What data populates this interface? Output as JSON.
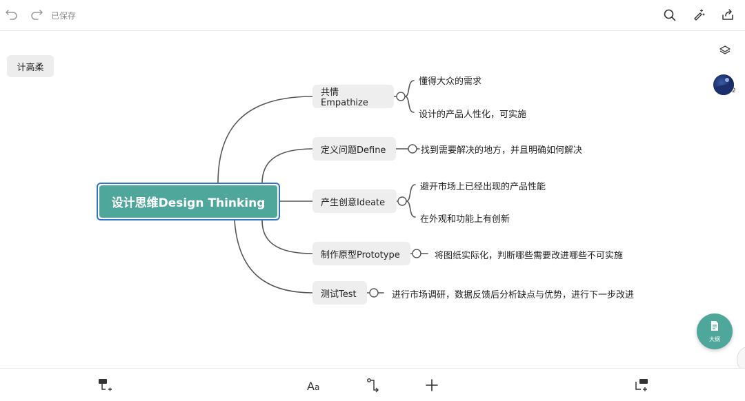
{
  "header": {
    "saved_label": "已保存",
    "icons": [
      "undo-icon",
      "redo-icon",
      "search-icon",
      "magic-wand-icon",
      "share-icon"
    ]
  },
  "user_chip": {
    "label": "计高柔"
  },
  "side": {
    "avatar_count": "2",
    "icons": [
      "layers-icon"
    ]
  },
  "mindmap": {
    "root": "设计思维Design Thinking",
    "branches": [
      {
        "label": "共情Empathize",
        "leaves": [
          "懂得大众的需求",
          "设计的产品人性化，可实施"
        ]
      },
      {
        "label": "定义问题Define",
        "leaves": [
          "找到需要解决的地方，并且明确如何解决"
        ]
      },
      {
        "label": "产生创意Ideate",
        "leaves": [
          "避开市场上已经出现的产品性能",
          "在外观和功能上有创新"
        ]
      },
      {
        "label": "制作原型Prototype",
        "leaves": [
          "将图纸实际化，判断哪些需要改进哪些不可实施"
        ]
      },
      {
        "label": "测试Test",
        "leaves": [
          "进行市场调研，数据反馈后分析缺点与优势，进行下一步改进"
        ]
      }
    ]
  },
  "fab": {
    "label": "大纲"
  },
  "bottom": {
    "icons": [
      "add-child-topic-icon",
      "text-style-icon",
      "connector-icon",
      "add-icon",
      "add-sibling-topic-icon"
    ]
  },
  "colors": {
    "accent": "#4fa79b",
    "selection": "#2f77c5",
    "node_bg": "#eeeeee",
    "line": "#555555"
  }
}
